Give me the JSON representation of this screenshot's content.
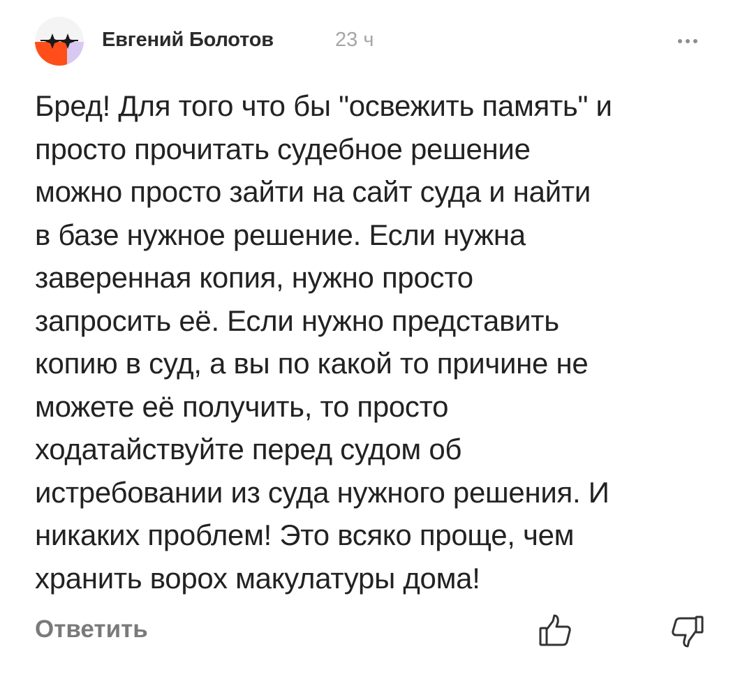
{
  "comment": {
    "author": "Евгений Болотов",
    "time": "23 ч",
    "avatar_icon": "avatar-image",
    "more_icon": "more-dots-icon",
    "text": "Бред! Для того что бы \"освежить память\" и\nпросто прочитать судебное решение\nможно просто зайти на сайт суда и найти\nв базе нужное решение. Если нужна\nзаверенная копия, нужно просто\nзапросить её. Если нужно представить\nкопию в суд, а вы по какой то причине не\nможете её получить, то просто\nходатайствуйте перед судом об\nистребовании из суда нужного решения. И\nникаких проблем! Это всяко проще, чем\nхранить ворох макулатуры дома!",
    "reply_label": "Ответить",
    "like_icon": "thumbs-up-icon",
    "dislike_icon": "thumbs-down-icon"
  },
  "colors": {
    "text": "#222222",
    "meta": "#a6a6a6",
    "reply": "#7a7a7a",
    "avatar_orange": "#ff4e1a",
    "avatar_lilac": "#d8c8f2"
  }
}
